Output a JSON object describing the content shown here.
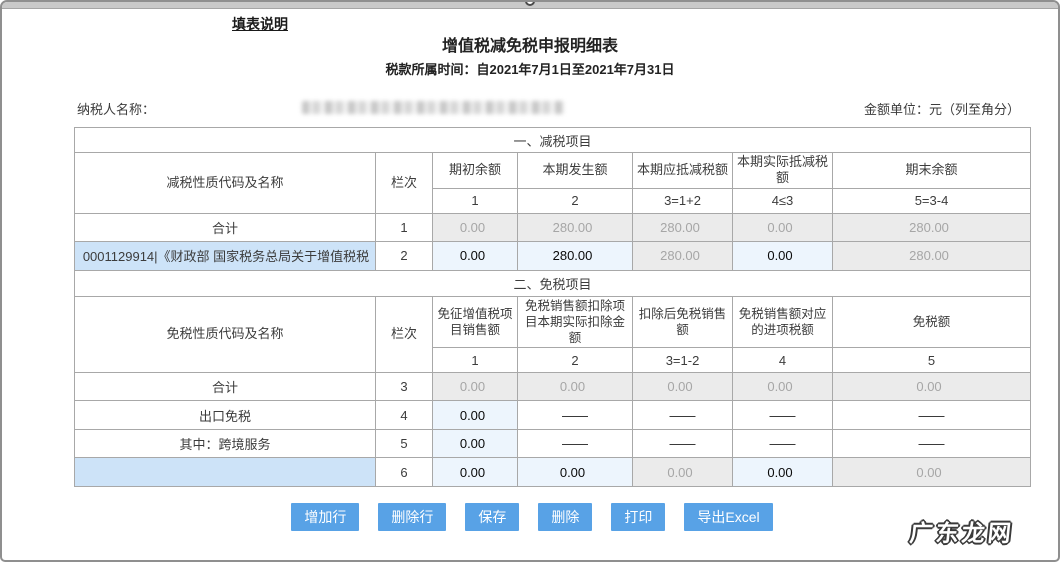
{
  "header": {
    "instructions_link": "填表说明",
    "title": "增值税减免税申报明细表",
    "tax_period": "税款所属时间：自2021年7月1日至2021年7月31日",
    "taxpayer_label": "纳税人名称：",
    "amount_unit": "金额单位：元（列至角分）"
  },
  "reduction": {
    "section_title": "一、减税项目",
    "name_header": "减税性质代码及名称",
    "line_header": "栏次",
    "columns": [
      "期初余额",
      "本期发生额",
      "本期应抵减税额",
      "本期实际抵减税额",
      "期末余额"
    ],
    "column_formulas": [
      "1",
      "2",
      "3=1+2",
      "4≤3",
      "5=3-4"
    ],
    "rows": [
      {
        "name": "合计",
        "line": "1",
        "c1": "0.00",
        "c2": "280.00",
        "c3": "280.00",
        "c4": "0.00",
        "c5": "280.00"
      },
      {
        "name": "0001129914|《财政部  国家税务总局关于增值税税",
        "line": "2",
        "c1": "0.00",
        "c2": "280.00",
        "c3": "280.00",
        "c4": "0.00",
        "c5": "280.00"
      }
    ]
  },
  "exemption": {
    "section_title": "二、免税项目",
    "name_header": "免税性质代码及名称",
    "line_header": "栏次",
    "columns": [
      "免征增值税项目销售额",
      "免税销售额扣除项目本期实际扣除金额",
      "扣除后免税销售额",
      "免税销售额对应的进项税额",
      "免税额"
    ],
    "column_formulas": [
      "1",
      "2",
      "3=1-2",
      "4",
      "5"
    ],
    "rows": [
      {
        "name": "合计",
        "line": "3",
        "c1": "0.00",
        "c2": "0.00",
        "c3": "0.00",
        "c4": "0.00",
        "c5": "0.00"
      },
      {
        "name": "出口免税",
        "line": "4",
        "c1": "0.00",
        "c2": "——",
        "c3": "——",
        "c4": "——",
        "c5": "——"
      },
      {
        "name": "其中：跨境服务",
        "line": "5",
        "c1": "0.00",
        "c2": "——",
        "c3": "——",
        "c4": "——",
        "c5": "——"
      },
      {
        "name": "",
        "line": "6",
        "c1": "0.00",
        "c2": "0.00",
        "c3": "0.00",
        "c4": "0.00",
        "c5": "0.00"
      }
    ]
  },
  "toolbar": {
    "buttons": [
      "增加行",
      "删除行",
      "保存",
      "删除",
      "打印",
      "导出Excel"
    ]
  },
  "watermark": "广东龙网",
  "colors": {
    "button_blue": "#58a2e6",
    "editable_cell": "#edf5fd",
    "readonly_cell": "#ebebeb",
    "selected_cell": "#cde3f8"
  }
}
